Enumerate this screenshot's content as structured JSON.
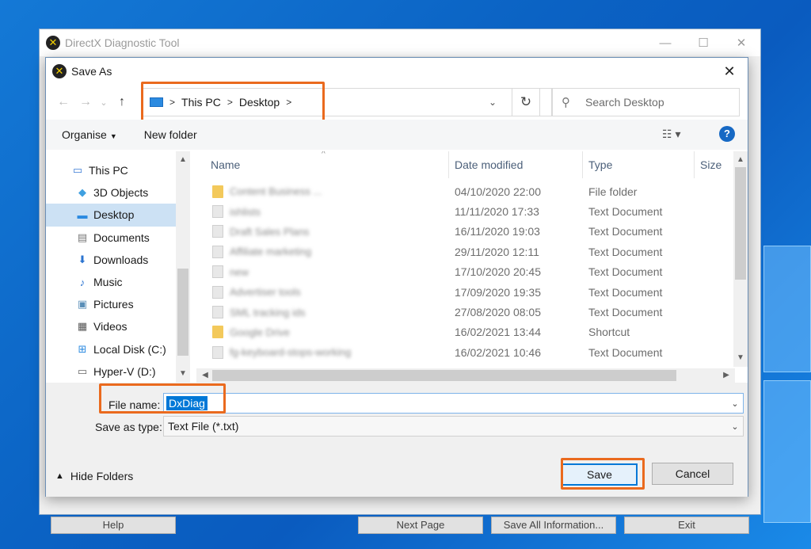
{
  "outer_window": {
    "title": "DirectX Diagnostic Tool",
    "bottom_buttons": [
      "Help",
      "Next Page",
      "Save All Information...",
      "Exit"
    ]
  },
  "dialog": {
    "title": "Save As",
    "breadcrumb": [
      "This PC",
      "Desktop"
    ],
    "search_placeholder": "Search Desktop",
    "toolbar": {
      "organise": "Organise",
      "new_folder": "New folder",
      "help": "?"
    },
    "sidebar": [
      {
        "label": "This PC",
        "icon": "computer-icon"
      },
      {
        "label": "3D Objects",
        "icon": "cube-icon"
      },
      {
        "label": "Desktop",
        "icon": "desktop-icon",
        "selected": true
      },
      {
        "label": "Documents",
        "icon": "document-icon"
      },
      {
        "label": "Downloads",
        "icon": "download-arrow-icon"
      },
      {
        "label": "Music",
        "icon": "music-note-icon"
      },
      {
        "label": "Pictures",
        "icon": "picture-icon"
      },
      {
        "label": "Videos",
        "icon": "film-icon"
      },
      {
        "label": "Local Disk (C:)",
        "icon": "windows-drive-icon"
      },
      {
        "label": "Hyper-V (D:)",
        "icon": "drive-icon"
      }
    ],
    "columns": {
      "name": "Name",
      "date": "Date modified",
      "type": "Type",
      "size": "Size"
    },
    "files": [
      {
        "name": "Content Business ...",
        "date": "04/10/2020 22:00",
        "type": "File folder",
        "icon": "folder-icon"
      },
      {
        "name": "ishlists",
        "date": "11/11/2020 17:33",
        "type": "Text Document",
        "icon": "text-file-icon"
      },
      {
        "name": "Draft Sales Plans",
        "date": "16/11/2020 19:03",
        "type": "Text Document",
        "icon": "text-file-icon"
      },
      {
        "name": "Affiliate marketing",
        "date": "29/11/2020 12:11",
        "type": "Text Document",
        "icon": "text-file-icon"
      },
      {
        "name": "new",
        "date": "17/10/2020 20:45",
        "type": "Text Document",
        "icon": "text-file-icon"
      },
      {
        "name": "Advertiser tools",
        "date": "17/09/2020 19:35",
        "type": "Text Document",
        "icon": "text-file-icon"
      },
      {
        "name": "SML tracking ids",
        "date": "27/08/2020 08:05",
        "type": "Text Document",
        "icon": "text-file-icon"
      },
      {
        "name": "Google Drive",
        "date": "16/02/2021 13:44",
        "type": "Shortcut",
        "icon": "shortcut-icon"
      },
      {
        "name": "fg-keyboard-stops-working",
        "date": "16/02/2021 10:46",
        "type": "Text Document",
        "icon": "text-file-icon"
      }
    ],
    "file_name_label": "File name:",
    "file_name_value": "DxDiag",
    "save_type_label": "Save as type:",
    "save_type_value": "Text File (*.txt)",
    "hide_folders": "Hide Folders",
    "save_button": "Save",
    "cancel_button": "Cancel"
  },
  "colors": {
    "annotation": "#ea6a1e",
    "selection": "#0078d7",
    "sidebar_selected": "#cce1f4"
  }
}
